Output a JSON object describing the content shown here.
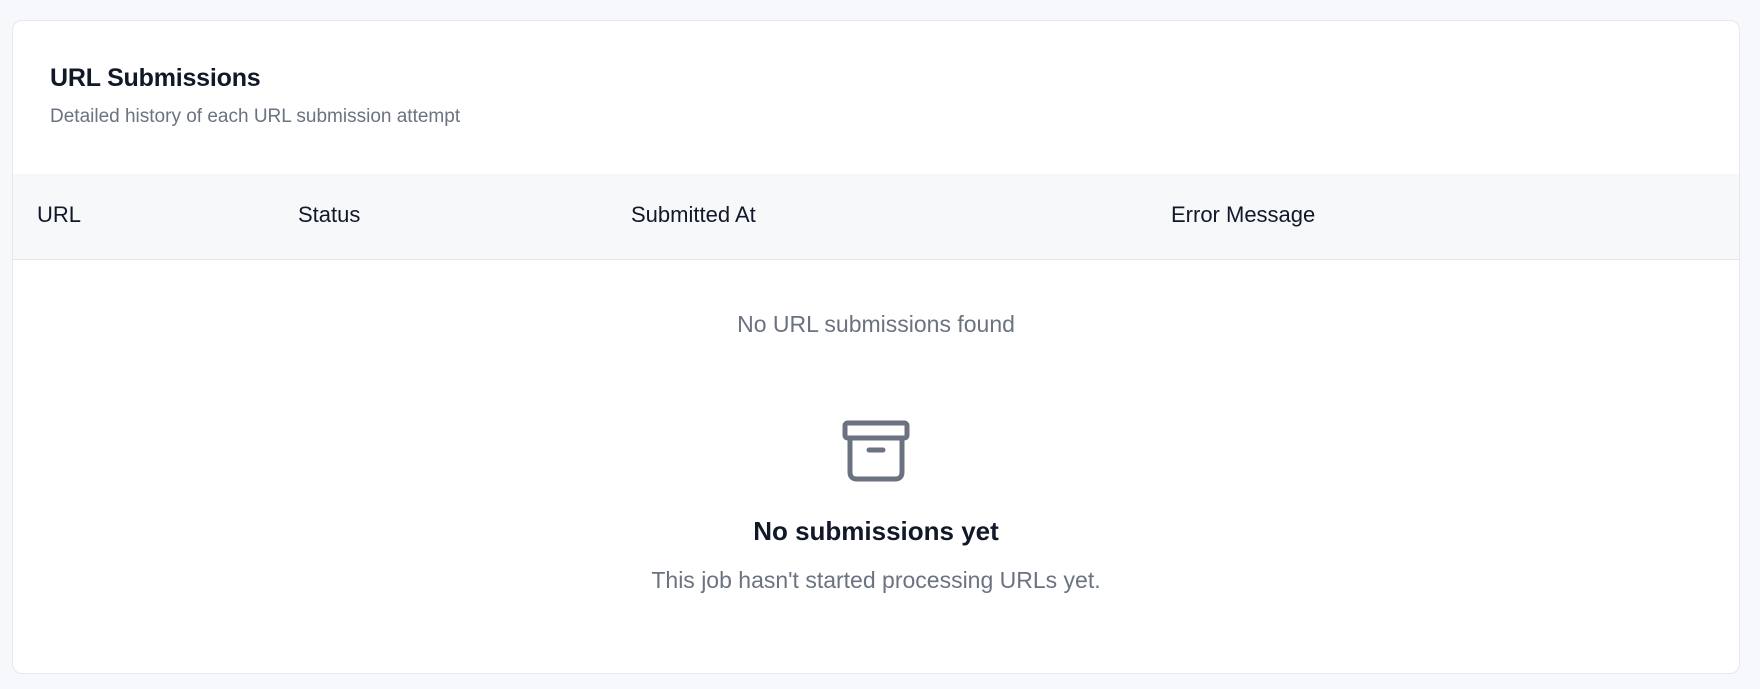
{
  "card": {
    "title": "URL Submissions",
    "subtitle": "Detailed history of each URL submission attempt"
  },
  "table": {
    "columns": [
      "URL",
      "Status",
      "Submitted At",
      "Error Message"
    ],
    "empty_message": "No URL submissions found"
  },
  "empty_state": {
    "icon": "archive-icon",
    "title": "No submissions yet",
    "description": "This job hasn't started processing URLs yet."
  },
  "colors": {
    "page_background": "#f7f8fb",
    "card_background": "#ffffff",
    "header_row_background": "#f7f8fa",
    "muted_text": "#6b7280",
    "primary_text": "#111827",
    "icon": "#6b7280"
  }
}
